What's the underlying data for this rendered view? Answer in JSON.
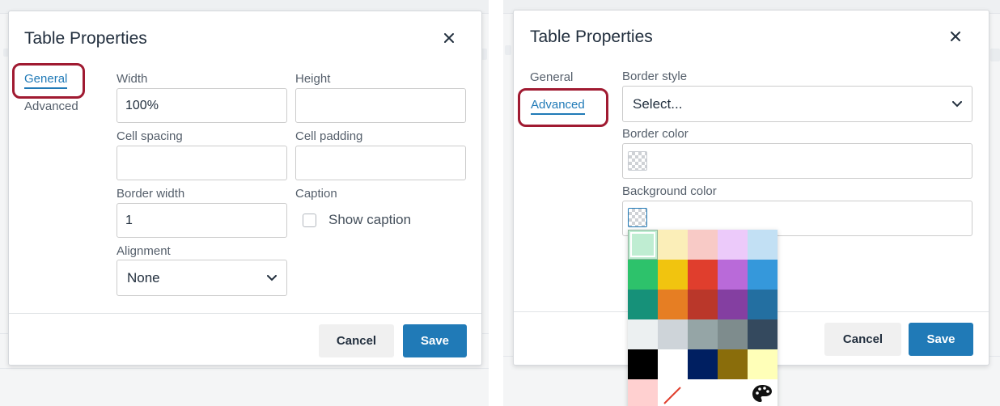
{
  "panel_general": {
    "title": "Table Properties",
    "tabs": [
      "General",
      "Advanced"
    ],
    "active_tab": "General",
    "fields": {
      "width_label": "Width",
      "width_value": "100%",
      "height_label": "Height",
      "height_value": "",
      "cell_spacing_label": "Cell spacing",
      "cell_spacing_value": "",
      "cell_padding_label": "Cell padding",
      "cell_padding_value": "",
      "border_width_label": "Border width",
      "border_width_value": "1",
      "caption_label": "Caption",
      "show_caption_label": "Show caption",
      "show_caption_checked": false,
      "alignment_label": "Alignment",
      "alignment_value": "None"
    },
    "buttons": {
      "cancel": "Cancel",
      "save": "Save"
    }
  },
  "panel_advanced": {
    "title": "Table Properties",
    "tabs": [
      "General",
      "Advanced"
    ],
    "active_tab": "Advanced",
    "fields": {
      "border_style_label": "Border style",
      "border_style_value": "Select...",
      "border_color_label": "Border color",
      "background_color_label": "Background color"
    },
    "buttons": {
      "cancel": "Cancel",
      "save": "Save"
    }
  },
  "color_palette": {
    "colors": [
      "#bfedd2",
      "#fbeeb8",
      "#f8cac6",
      "#eccafa",
      "#c2e0f4",
      "#2dc26b",
      "#f1c40f",
      "#e03e2d",
      "#b96ad9",
      "#3598db",
      "#169179",
      "#e67e23",
      "#ba372a",
      "#843fa1",
      "#236fa1",
      "#ecf0f1",
      "#ced4d9",
      "#95a5a6",
      "#7e8c8d",
      "#34495e",
      "#000000",
      "#ffffff",
      "#001f61",
      "#8a6d0b",
      "#ffffb8",
      "#ffd0d0"
    ],
    "selected": "#bfedd2",
    "remove_icon": "remove-color-slash-icon",
    "custom_icon": "palette-icon"
  },
  "accent_color": "#207ab7",
  "highlight_color": "#a01a31"
}
